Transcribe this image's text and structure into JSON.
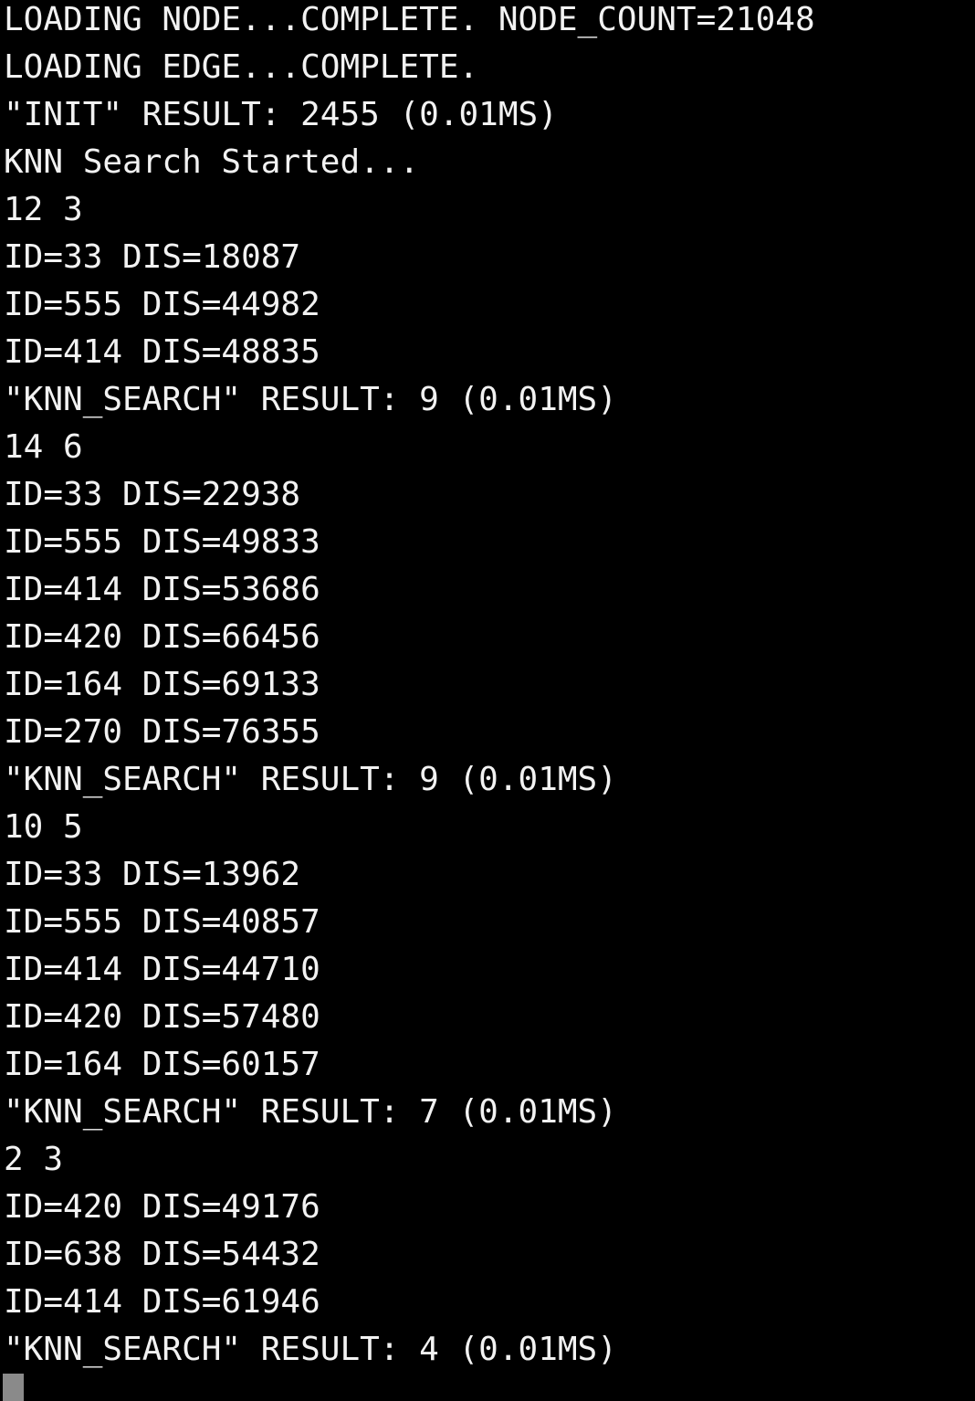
{
  "terminal": {
    "lines": [
      "LOADING NODE...COMPLETE. NODE_COUNT=21048",
      "LOADING EDGE...COMPLETE.",
      "\"INIT\" RESULT: 2455 (0.01MS)",
      "KNN Search Started...",
      "12 3",
      "ID=33 DIS=18087",
      "ID=555 DIS=44982",
      "ID=414 DIS=48835",
      "\"KNN_SEARCH\" RESULT: 9 (0.01MS)",
      "14 6",
      "ID=33 DIS=22938",
      "ID=555 DIS=49833",
      "ID=414 DIS=53686",
      "ID=420 DIS=66456",
      "ID=164 DIS=69133",
      "ID=270 DIS=76355",
      "\"KNN_SEARCH\" RESULT: 9 (0.01MS)",
      "10 5",
      "ID=33 DIS=13962",
      "ID=555 DIS=40857",
      "ID=414 DIS=44710",
      "ID=420 DIS=57480",
      "ID=164 DIS=60157",
      "\"KNN_SEARCH\" RESULT: 7 (0.01MS)",
      "2 3",
      "ID=420 DIS=49176",
      "ID=638 DIS=54432",
      "ID=414 DIS=61946",
      "\"KNN_SEARCH\" RESULT: 4 (0.01MS)"
    ]
  }
}
